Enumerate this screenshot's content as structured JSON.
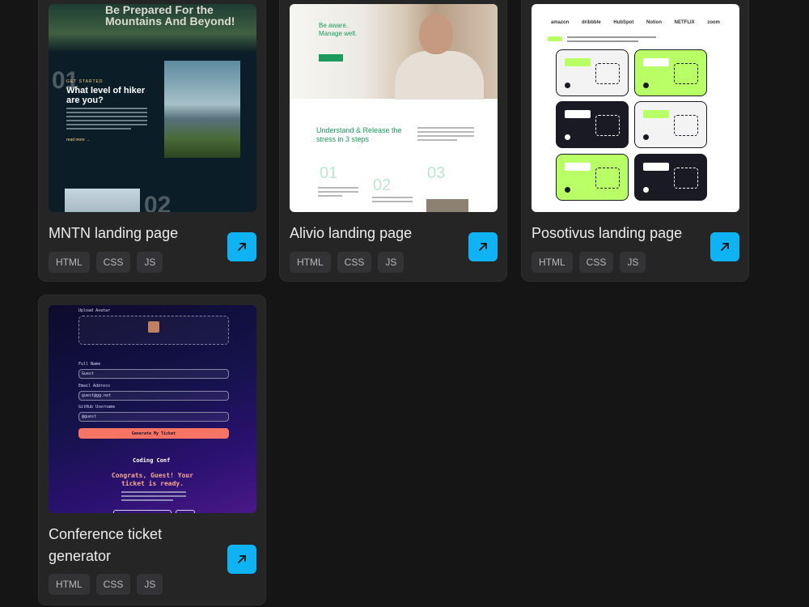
{
  "projects": [
    {
      "title": "MNTN landing page",
      "tags": [
        "HTML",
        "CSS",
        "JS"
      ],
      "preview": {
        "heading": "Be Prepared For the Mountains And Beyond!",
        "section_number": "01",
        "section_number_2": "02",
        "eyebrow": "GET STARTED",
        "question": "What level of hiker are you?",
        "read_more": "read more  →"
      }
    },
    {
      "title": "Alivio landing page",
      "tags": [
        "HTML",
        "CSS",
        "JS"
      ],
      "preview": {
        "hero_text": "Be aware. Manage well.",
        "steps_heading": "Understand & Release the stress in 3 steps",
        "step_1": "01",
        "step_2": "02",
        "step_3": "03"
      }
    },
    {
      "title": "Posotivus landing page",
      "tags": [
        "HTML",
        "CSS",
        "JS"
      ],
      "preview": {
        "logos": "amazon dribbble HubSpot Notion NETFLIX zoom"
      }
    },
    {
      "title": "Conference ticket generator",
      "tags": [
        "HTML",
        "CSS",
        "JS"
      ],
      "preview": {
        "upload_label": "Upload Avatar",
        "full_name_label": "Full Name",
        "full_name_value": "Guest",
        "email_label": "Email Address",
        "email_value": "guest@gg.net",
        "github_label": "GitHub Username",
        "github_value": "@guest",
        "generate_button": "Generate My Ticket",
        "logo_text": "Coding Conf",
        "congrats": "Congrats, Guest! Your ticket is ready."
      }
    }
  ],
  "colors": {
    "background": "#151515",
    "card": "#252526",
    "accent": "#0fb3f3",
    "tag_bg": "#333335"
  },
  "icons": {
    "open": "arrow-up-right-icon"
  }
}
